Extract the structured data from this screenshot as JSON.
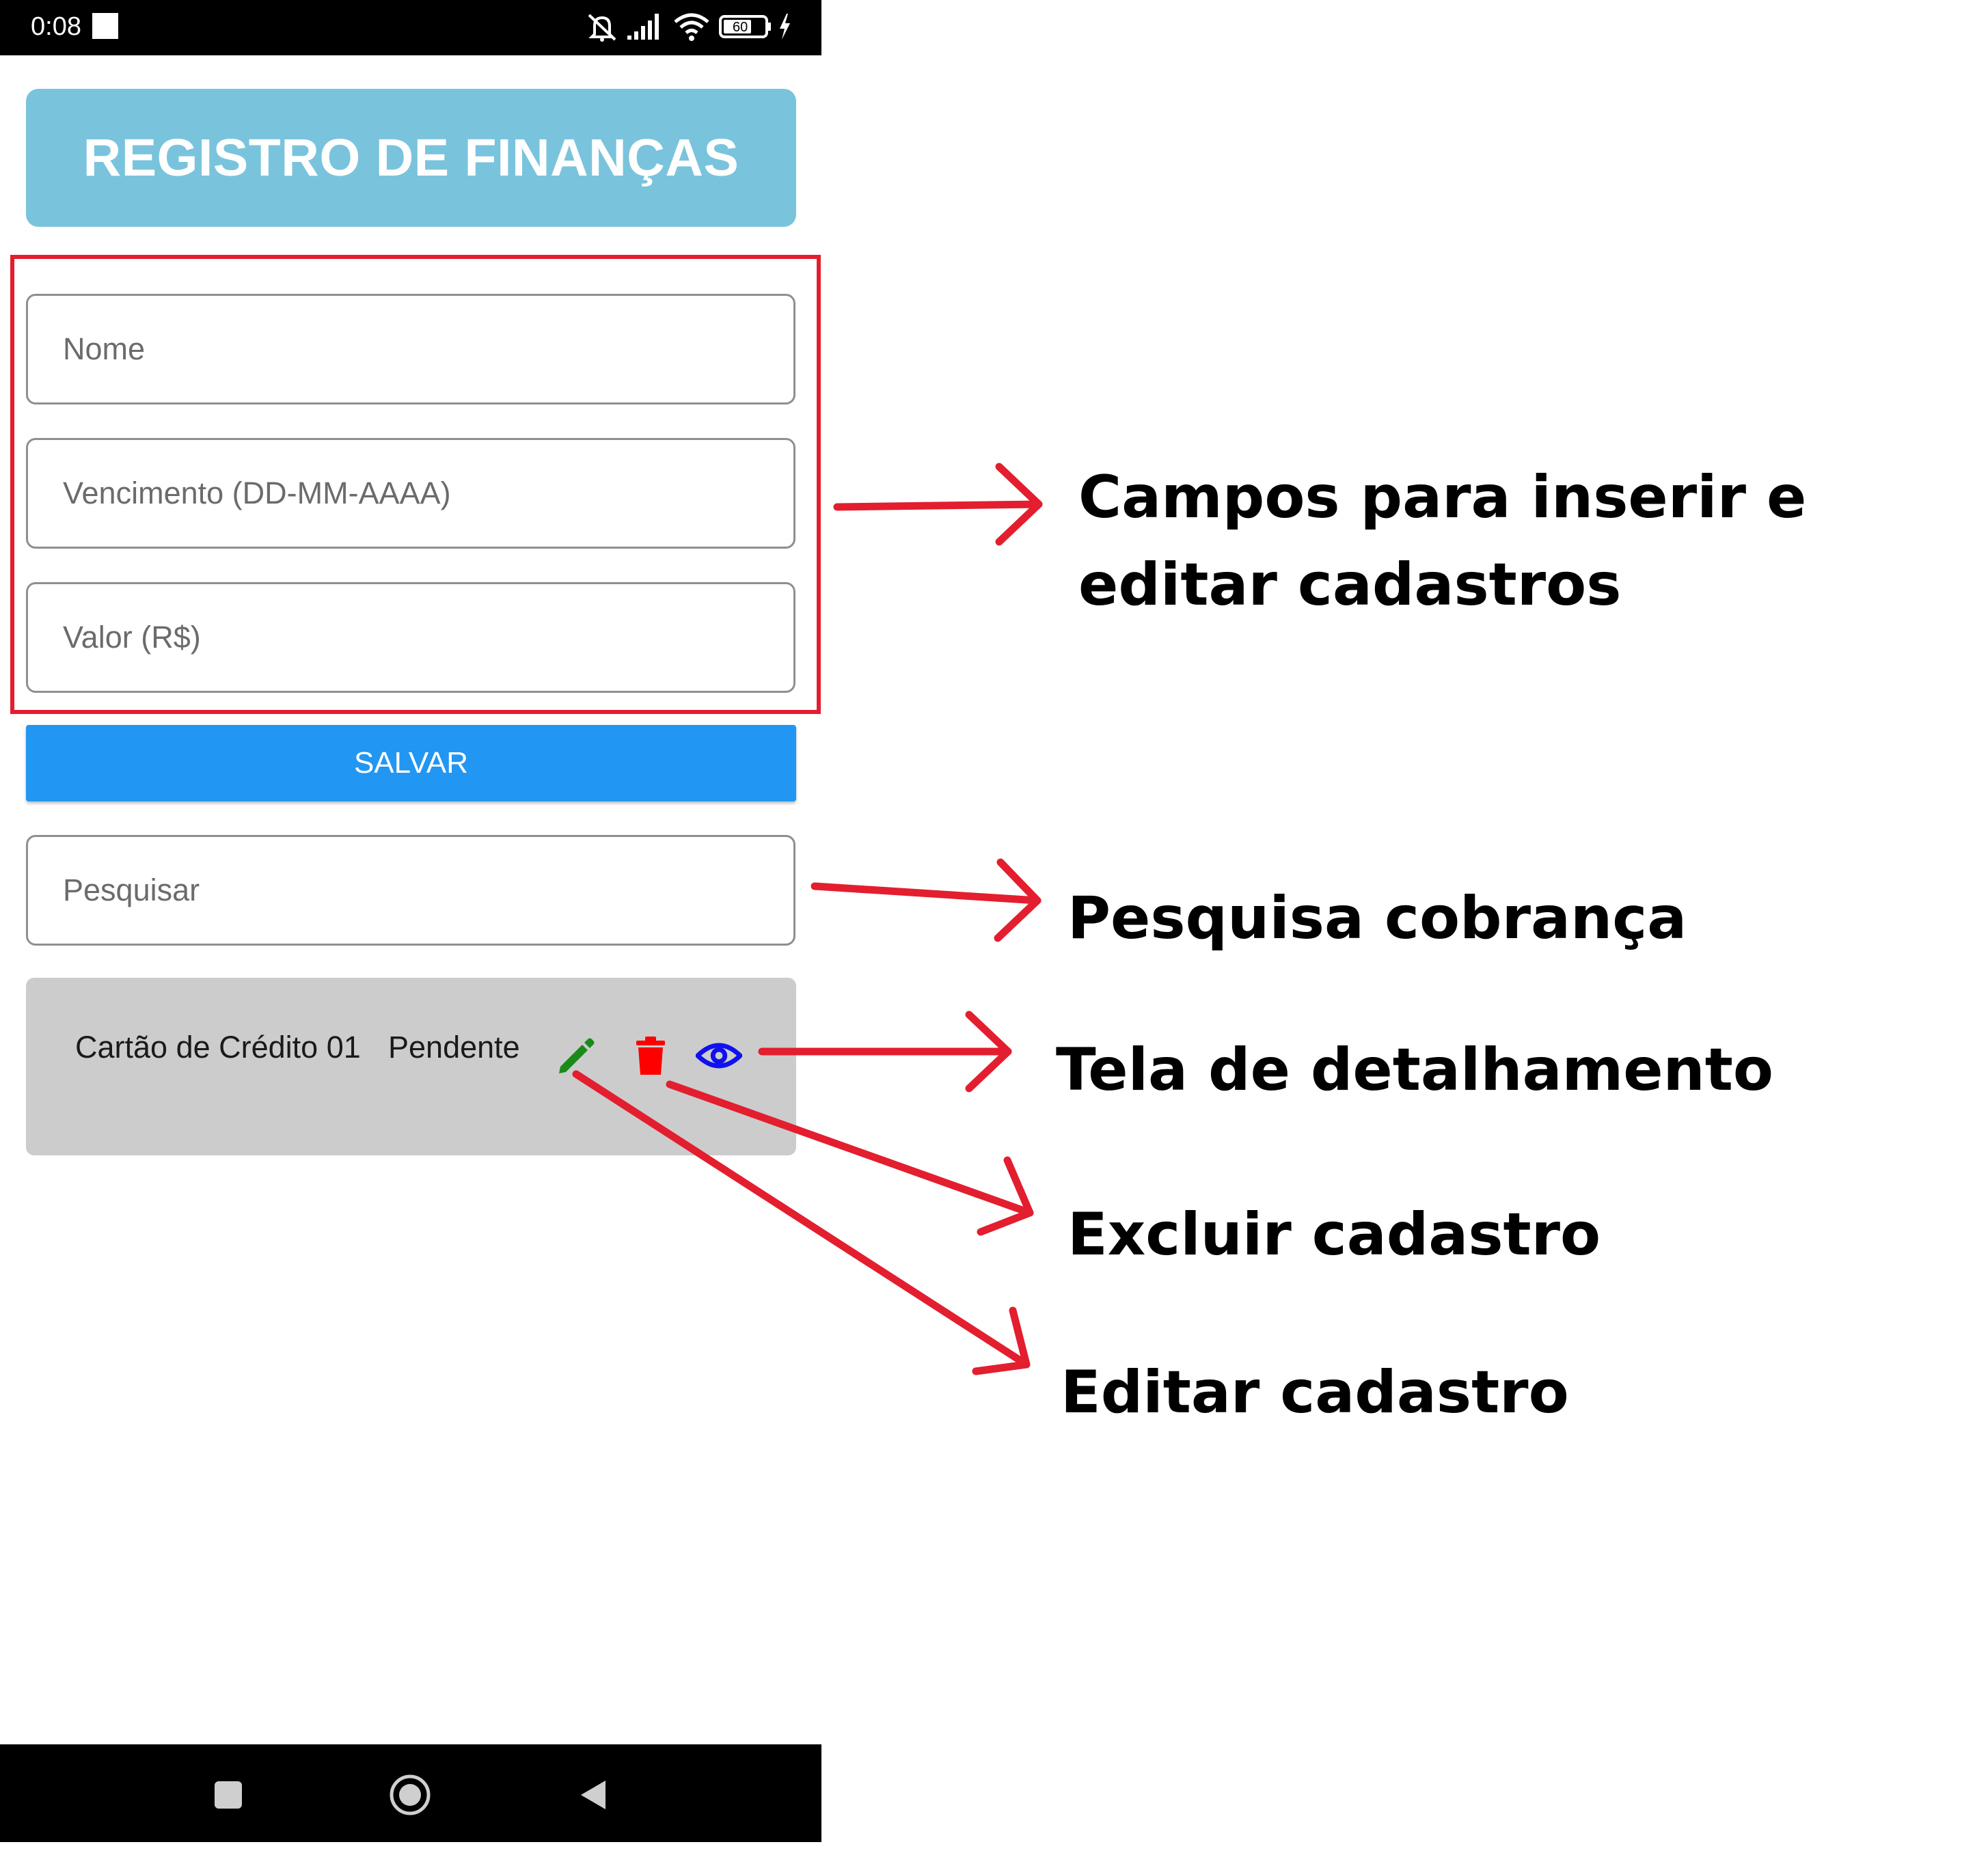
{
  "status_bar": {
    "time": "0:08",
    "battery": "60"
  },
  "header": {
    "title": "REGISTRO DE FINANÇAS"
  },
  "form": {
    "name_placeholder": "Nome",
    "name_value": "",
    "due_placeholder": "Vencimento (DD-MM-AAAA)",
    "due_value": "",
    "value_placeholder": "Valor (R$)",
    "value_value": "",
    "save_label": "SALVAR"
  },
  "search": {
    "placeholder": "Pesquisar",
    "value": ""
  },
  "items": [
    {
      "name": "Cartão de Crédito 01",
      "status": "Pendente"
    }
  ],
  "icons": {
    "edit": "pencil-icon",
    "delete": "trash-icon",
    "view": "eye-icon"
  },
  "colors": {
    "header_bg": "#79c4dc",
    "save_button": "#2196f3",
    "card_bg": "#cccccc",
    "edit_icon": "#1a8a1a",
    "delete_icon": "#ff0000",
    "view_icon": "#1111ee",
    "annotation": "#e31e2f"
  },
  "annotations": {
    "fields_line1": "Campos para inserir e",
    "fields_line2": "editar cadastros",
    "search": "Pesquisa cobrança",
    "detail": "Tela de detalhamento",
    "delete": "Excluir cadastro",
    "edit": "Editar cadastro"
  }
}
